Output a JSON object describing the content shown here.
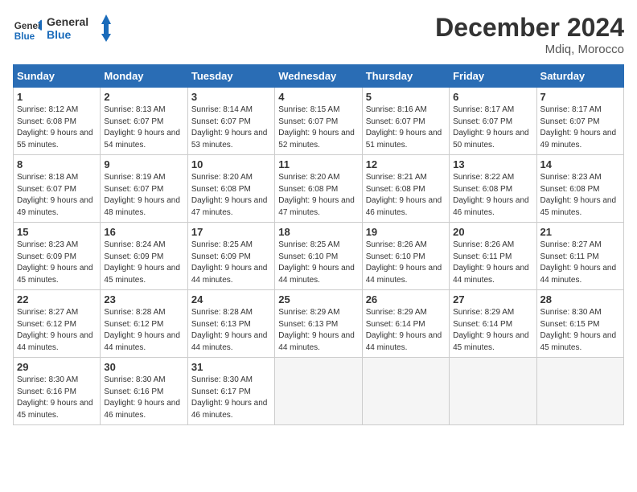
{
  "logo": {
    "line1": "General",
    "line2": "Blue"
  },
  "title": "December 2024",
  "location": "Mdiq, Morocco",
  "weekdays": [
    "Sunday",
    "Monday",
    "Tuesday",
    "Wednesday",
    "Thursday",
    "Friday",
    "Saturday"
  ],
  "weeks": [
    [
      {
        "day": "1",
        "sunrise": "Sunrise: 8:12 AM",
        "sunset": "Sunset: 6:08 PM",
        "daylight": "Daylight: 9 hours and 55 minutes."
      },
      {
        "day": "2",
        "sunrise": "Sunrise: 8:13 AM",
        "sunset": "Sunset: 6:07 PM",
        "daylight": "Daylight: 9 hours and 54 minutes."
      },
      {
        "day": "3",
        "sunrise": "Sunrise: 8:14 AM",
        "sunset": "Sunset: 6:07 PM",
        "daylight": "Daylight: 9 hours and 53 minutes."
      },
      {
        "day": "4",
        "sunrise": "Sunrise: 8:15 AM",
        "sunset": "Sunset: 6:07 PM",
        "daylight": "Daylight: 9 hours and 52 minutes."
      },
      {
        "day": "5",
        "sunrise": "Sunrise: 8:16 AM",
        "sunset": "Sunset: 6:07 PM",
        "daylight": "Daylight: 9 hours and 51 minutes."
      },
      {
        "day": "6",
        "sunrise": "Sunrise: 8:17 AM",
        "sunset": "Sunset: 6:07 PM",
        "daylight": "Daylight: 9 hours and 50 minutes."
      },
      {
        "day": "7",
        "sunrise": "Sunrise: 8:17 AM",
        "sunset": "Sunset: 6:07 PM",
        "daylight": "Daylight: 9 hours and 49 minutes."
      }
    ],
    [
      {
        "day": "8",
        "sunrise": "Sunrise: 8:18 AM",
        "sunset": "Sunset: 6:07 PM",
        "daylight": "Daylight: 9 hours and 49 minutes."
      },
      {
        "day": "9",
        "sunrise": "Sunrise: 8:19 AM",
        "sunset": "Sunset: 6:07 PM",
        "daylight": "Daylight: 9 hours and 48 minutes."
      },
      {
        "day": "10",
        "sunrise": "Sunrise: 8:20 AM",
        "sunset": "Sunset: 6:08 PM",
        "daylight": "Daylight: 9 hours and 47 minutes."
      },
      {
        "day": "11",
        "sunrise": "Sunrise: 8:20 AM",
        "sunset": "Sunset: 6:08 PM",
        "daylight": "Daylight: 9 hours and 47 minutes."
      },
      {
        "day": "12",
        "sunrise": "Sunrise: 8:21 AM",
        "sunset": "Sunset: 6:08 PM",
        "daylight": "Daylight: 9 hours and 46 minutes."
      },
      {
        "day": "13",
        "sunrise": "Sunrise: 8:22 AM",
        "sunset": "Sunset: 6:08 PM",
        "daylight": "Daylight: 9 hours and 46 minutes."
      },
      {
        "day": "14",
        "sunrise": "Sunrise: 8:23 AM",
        "sunset": "Sunset: 6:08 PM",
        "daylight": "Daylight: 9 hours and 45 minutes."
      }
    ],
    [
      {
        "day": "15",
        "sunrise": "Sunrise: 8:23 AM",
        "sunset": "Sunset: 6:09 PM",
        "daylight": "Daylight: 9 hours and 45 minutes."
      },
      {
        "day": "16",
        "sunrise": "Sunrise: 8:24 AM",
        "sunset": "Sunset: 6:09 PM",
        "daylight": "Daylight: 9 hours and 45 minutes."
      },
      {
        "day": "17",
        "sunrise": "Sunrise: 8:25 AM",
        "sunset": "Sunset: 6:09 PM",
        "daylight": "Daylight: 9 hours and 44 minutes."
      },
      {
        "day": "18",
        "sunrise": "Sunrise: 8:25 AM",
        "sunset": "Sunset: 6:10 PM",
        "daylight": "Daylight: 9 hours and 44 minutes."
      },
      {
        "day": "19",
        "sunrise": "Sunrise: 8:26 AM",
        "sunset": "Sunset: 6:10 PM",
        "daylight": "Daylight: 9 hours and 44 minutes."
      },
      {
        "day": "20",
        "sunrise": "Sunrise: 8:26 AM",
        "sunset": "Sunset: 6:11 PM",
        "daylight": "Daylight: 9 hours and 44 minutes."
      },
      {
        "day": "21",
        "sunrise": "Sunrise: 8:27 AM",
        "sunset": "Sunset: 6:11 PM",
        "daylight": "Daylight: 9 hours and 44 minutes."
      }
    ],
    [
      {
        "day": "22",
        "sunrise": "Sunrise: 8:27 AM",
        "sunset": "Sunset: 6:12 PM",
        "daylight": "Daylight: 9 hours and 44 minutes."
      },
      {
        "day": "23",
        "sunrise": "Sunrise: 8:28 AM",
        "sunset": "Sunset: 6:12 PM",
        "daylight": "Daylight: 9 hours and 44 minutes."
      },
      {
        "day": "24",
        "sunrise": "Sunrise: 8:28 AM",
        "sunset": "Sunset: 6:13 PM",
        "daylight": "Daylight: 9 hours and 44 minutes."
      },
      {
        "day": "25",
        "sunrise": "Sunrise: 8:29 AM",
        "sunset": "Sunset: 6:13 PM",
        "daylight": "Daylight: 9 hours and 44 minutes."
      },
      {
        "day": "26",
        "sunrise": "Sunrise: 8:29 AM",
        "sunset": "Sunset: 6:14 PM",
        "daylight": "Daylight: 9 hours and 44 minutes."
      },
      {
        "day": "27",
        "sunrise": "Sunrise: 8:29 AM",
        "sunset": "Sunset: 6:14 PM",
        "daylight": "Daylight: 9 hours and 45 minutes."
      },
      {
        "day": "28",
        "sunrise": "Sunrise: 8:30 AM",
        "sunset": "Sunset: 6:15 PM",
        "daylight": "Daylight: 9 hours and 45 minutes."
      }
    ],
    [
      {
        "day": "29",
        "sunrise": "Sunrise: 8:30 AM",
        "sunset": "Sunset: 6:16 PM",
        "daylight": "Daylight: 9 hours and 45 minutes."
      },
      {
        "day": "30",
        "sunrise": "Sunrise: 8:30 AM",
        "sunset": "Sunset: 6:16 PM",
        "daylight": "Daylight: 9 hours and 46 minutes."
      },
      {
        "day": "31",
        "sunrise": "Sunrise: 8:30 AM",
        "sunset": "Sunset: 6:17 PM",
        "daylight": "Daylight: 9 hours and 46 minutes."
      },
      null,
      null,
      null,
      null
    ]
  ]
}
